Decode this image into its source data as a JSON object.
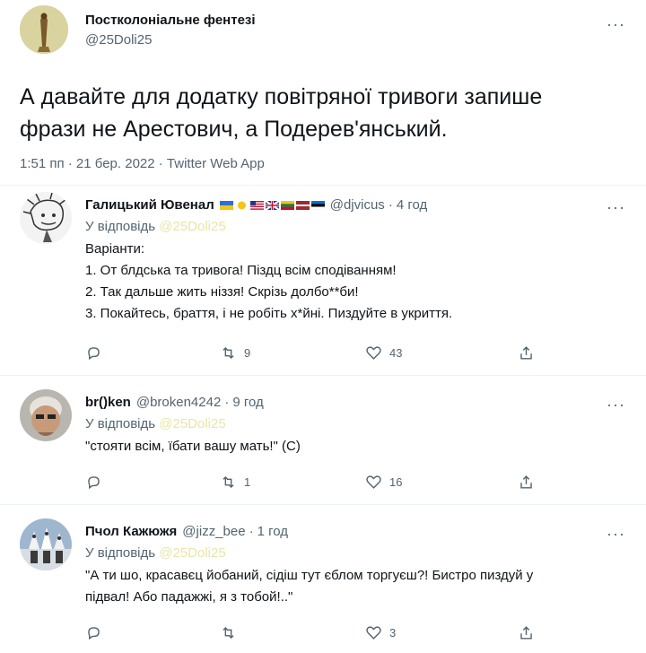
{
  "main_tweet": {
    "author_name": "Постколоніальне фентезі",
    "handle": "@25Doli25",
    "text_line1": "А давайте для додатку повітряної тривоги запише",
    "text_line2": "фрази не Арестович, а Подерев'янський.",
    "meta": "1:51 пп · 21 бер. 2022 · Twitter Web App",
    "more_icon": "more-icon"
  },
  "replies": [
    {
      "name": "Галицький Ювенал",
      "handle": "@djvicus",
      "dot": "·",
      "time": "4 год",
      "replying_prefix": "У відповідь",
      "replying_to": "@25Doli25",
      "lines": [
        "Варіанти:",
        "1. От блдська та тривога! Піздц всім сподіванням!",
        "2. Так дальше жить ніззя! Скрізь долбо**би!",
        "3. Покайтесь, браття, і не робіть х*йні. Пиздуйте в  укриття."
      ],
      "retweets": "9",
      "likes": "43"
    },
    {
      "name": "br()ken",
      "handle": "@broken4242",
      "dot": "·",
      "time": "9 год",
      "replying_prefix": "У відповідь",
      "replying_to": "@25Doli25",
      "lines": [
        "\"стояти всім, їбати вашу мать!\" (С)"
      ],
      "retweets": "1",
      "likes": "16"
    },
    {
      "name": "Пчол Кажюжя",
      "handle": "@jizz_bee",
      "dot": "·",
      "time": "1 год",
      "replying_prefix": "У відповідь",
      "replying_to": "@25Doli25",
      "lines": [
        "\"А ти шо, красавєц йобаний, сідіш тут єблом торгуєш?! Бистро пиздуй у",
        "підвал! Або падажжі, я з тобой!..\""
      ],
      "retweets": "",
      "likes": "3"
    }
  ],
  "colors": {
    "text": "#0f1419",
    "secondary": "#536471",
    "mention_faded": "#e9e6a6",
    "divider": "#eff3f4"
  }
}
